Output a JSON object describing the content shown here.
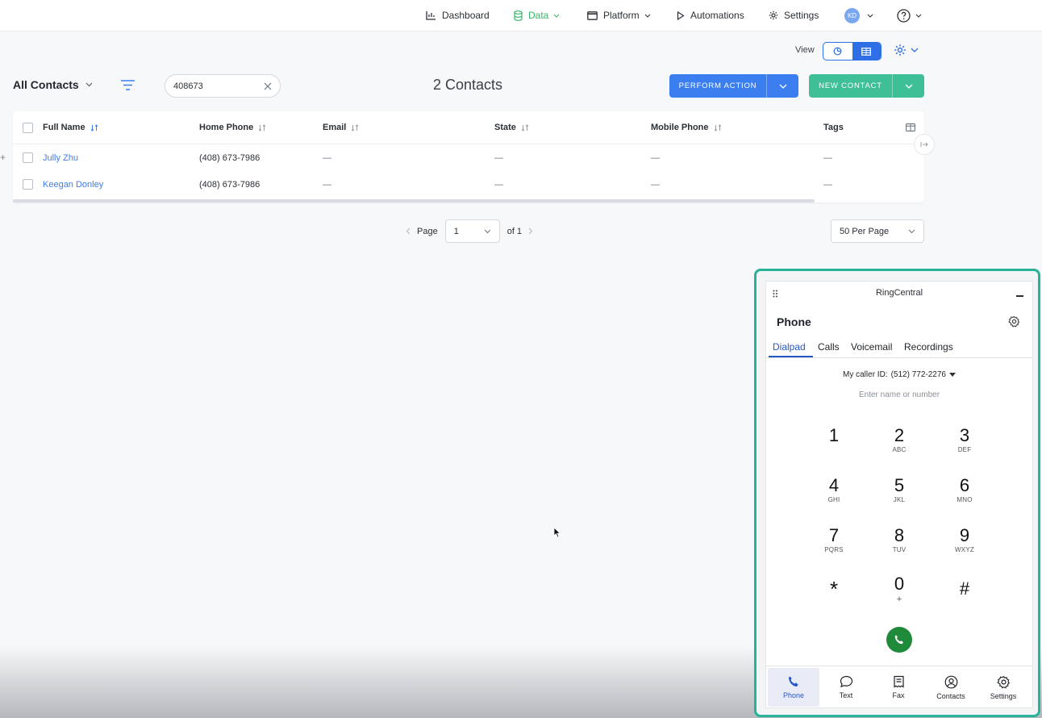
{
  "topnav": {
    "dashboard": "Dashboard",
    "data": "Data",
    "platform": "Platform",
    "automations": "Automations",
    "settings": "Settings",
    "avatar_initials": "KD"
  },
  "view": {
    "label": "View"
  },
  "toolbar": {
    "list_name": "All Contacts",
    "search_value": "408673",
    "count_title": "2 Contacts",
    "perform_action": "PERFORM ACTION",
    "new_contact": "NEW CONTACT"
  },
  "table": {
    "headers": [
      "Full Name",
      "Home Phone",
      "Email",
      "State",
      "Mobile Phone",
      "Tags"
    ],
    "rows": [
      {
        "name": "Jully Zhu",
        "home_phone": "(408) 673-7986",
        "email": "—",
        "state": "—",
        "mobile": "—",
        "tags": "—"
      },
      {
        "name": "Keegan Donley",
        "home_phone": "(408) 673-7986",
        "email": "—",
        "state": "—",
        "mobile": "—",
        "tags": "—"
      }
    ]
  },
  "pager": {
    "page_label": "Page",
    "page_value": "1",
    "of_label": "of 1",
    "per_page": "50 Per Page"
  },
  "ringcentral": {
    "title": "RingCentral",
    "heading": "Phone",
    "tabs": [
      "Dialpad",
      "Calls",
      "Voicemail",
      "Recordings"
    ],
    "caller_id_label": "My caller ID:",
    "caller_id_value": "(512) 772-2276",
    "input_placeholder": "Enter name or number",
    "keys": [
      {
        "num": "1",
        "sub": ""
      },
      {
        "num": "2",
        "sub": "ABC"
      },
      {
        "num": "3",
        "sub": "DEF"
      },
      {
        "num": "4",
        "sub": "GHI"
      },
      {
        "num": "5",
        "sub": "JKL"
      },
      {
        "num": "6",
        "sub": "MNO"
      },
      {
        "num": "7",
        "sub": "PQRS"
      },
      {
        "num": "8",
        "sub": "TUV"
      },
      {
        "num": "9",
        "sub": "WXYZ"
      },
      {
        "num": "*",
        "sub": ""
      },
      {
        "num": "0",
        "sub": "+"
      },
      {
        "num": "#",
        "sub": ""
      }
    ],
    "nav": [
      "Phone",
      "Text",
      "Fax",
      "Contacts",
      "Settings"
    ]
  },
  "colors": {
    "accent_blue": "#3b7ef0",
    "accent_green": "#3fbf96",
    "active_nav_green": "#3bb36a",
    "widget_border": "#27b39a",
    "call_green": "#1f8a3a",
    "rc_blue": "#2559c9"
  }
}
